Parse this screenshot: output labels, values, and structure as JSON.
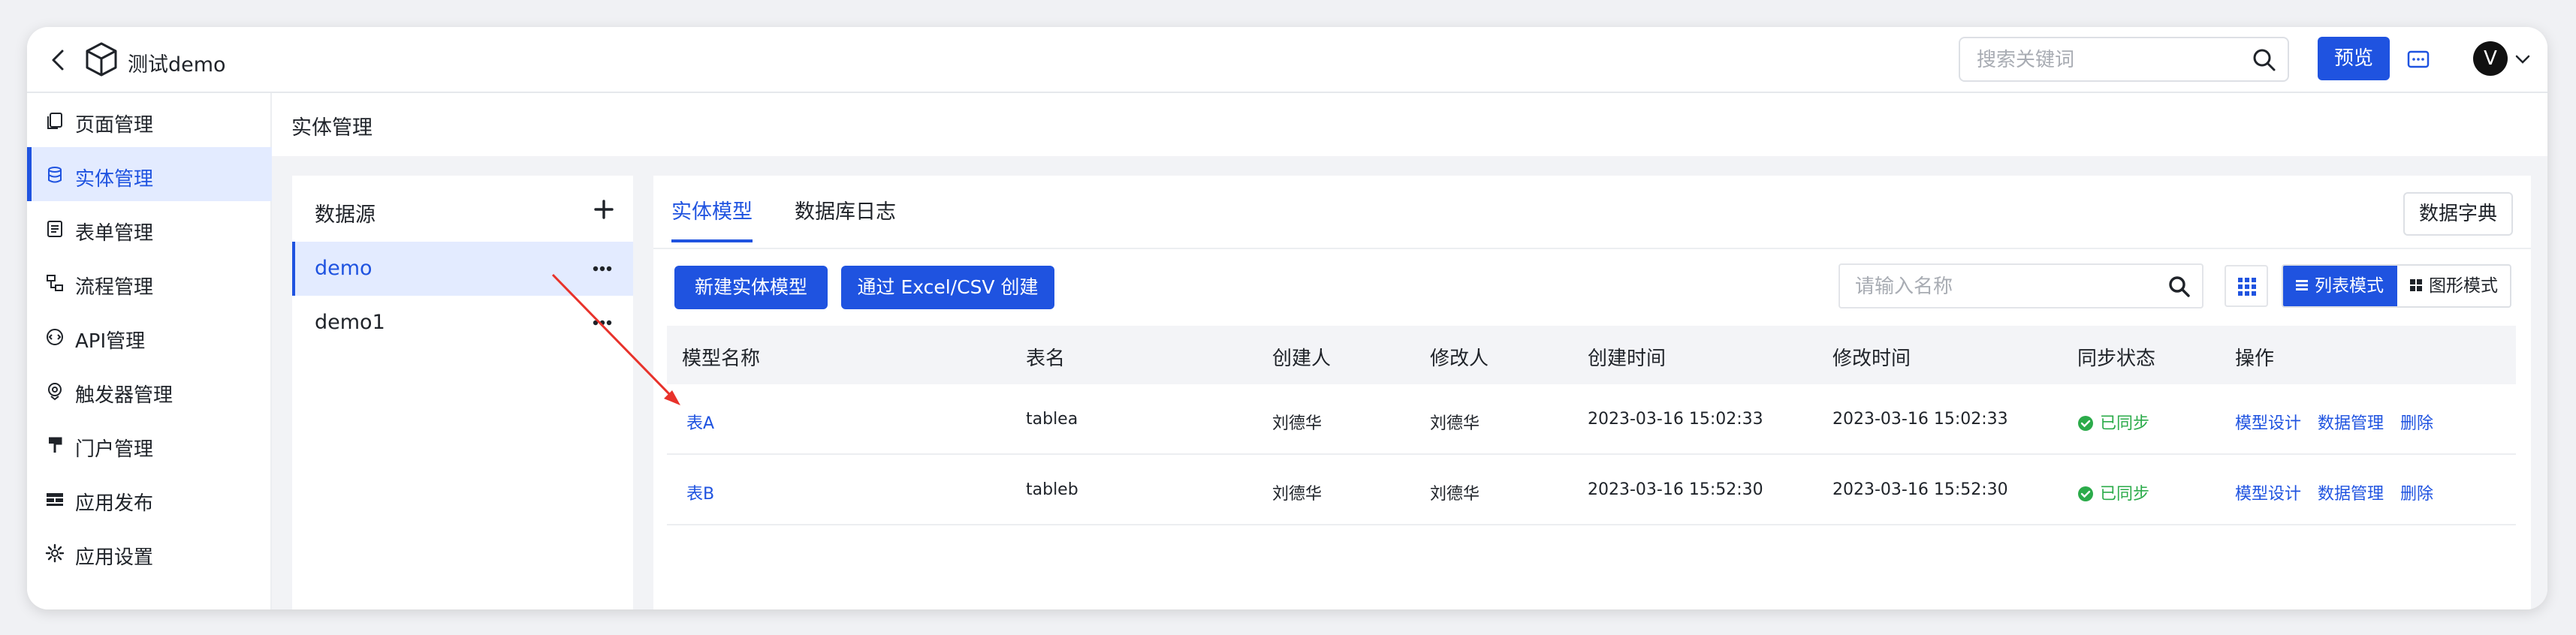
{
  "header": {
    "app_title": "测试demo",
    "search_placeholder": "搜索关键词",
    "preview_label": "预览",
    "avatar_letter": "V"
  },
  "sidebar": {
    "items": [
      {
        "label": "页面管理",
        "icon": "pages-icon"
      },
      {
        "label": "实体管理",
        "icon": "database-icon",
        "active": true
      },
      {
        "label": "表单管理",
        "icon": "form-icon"
      },
      {
        "label": "流程管理",
        "icon": "flow-icon"
      },
      {
        "label": "API管理",
        "icon": "api-icon"
      },
      {
        "label": "触发器管理",
        "icon": "trigger-icon"
      },
      {
        "label": "门户管理",
        "icon": "portal-icon"
      },
      {
        "label": "应用发布",
        "icon": "publish-icon"
      },
      {
        "label": "应用设置",
        "icon": "gear-icon"
      }
    ]
  },
  "page": {
    "title": "实体管理"
  },
  "datasource": {
    "title": "数据源",
    "items": [
      {
        "label": "demo",
        "active": true
      },
      {
        "label": "demo1"
      }
    ]
  },
  "main": {
    "tabs": [
      {
        "label": "实体模型",
        "active": true
      },
      {
        "label": "数据库日志"
      }
    ],
    "dict_button": "数据字典",
    "new_model_button": "新建实体模型",
    "import_button": "通过 Excel/CSV 创建",
    "name_search_placeholder": "请输入名称",
    "list_mode": "列表模式",
    "graph_mode": "图形模式"
  },
  "table": {
    "columns": [
      "模型名称",
      "表名",
      "创建人",
      "修改人",
      "创建时间",
      "修改时间",
      "同步状态",
      "操作"
    ],
    "rows": [
      {
        "name": "表A",
        "table": "tablea",
        "creator": "刘德华",
        "modifier": "刘德华",
        "created": "2023-03-16 15:02:33",
        "modified": "2023-03-16 15:02:33",
        "status": "已同步",
        "ops": [
          "模型设计",
          "数据管理",
          "删除"
        ]
      },
      {
        "name": "表B",
        "table": "tableb",
        "creator": "刘德华",
        "modifier": "刘德华",
        "created": "2023-03-16 15:52:30",
        "modified": "2023-03-16 15:52:30",
        "status": "已同步",
        "ops": [
          "模型设计",
          "数据管理",
          "删除"
        ]
      }
    ]
  },
  "colors": {
    "primary": "#1f53e0",
    "success": "#2bab4a",
    "annotation_arrow": "#e8322b"
  }
}
